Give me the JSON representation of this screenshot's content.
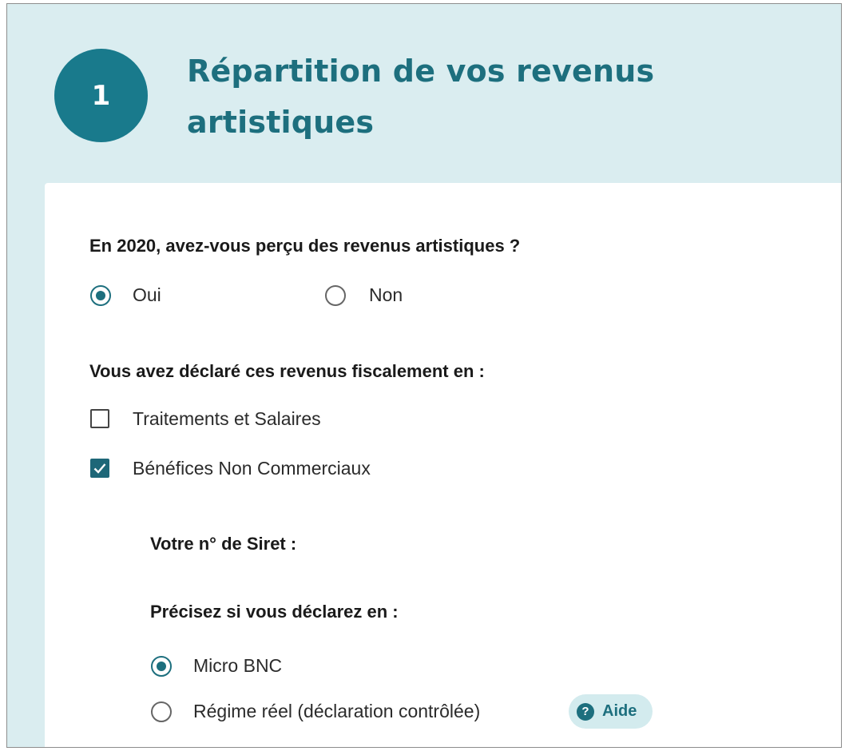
{
  "section": {
    "step_number": "1",
    "title": "Répartition de vos revenus artistiques"
  },
  "q_income": {
    "question": "En 2020, avez-vous perçu des revenus artistiques ?",
    "options": [
      {
        "label": "Oui",
        "selected": true
      },
      {
        "label": "Non",
        "selected": false
      }
    ]
  },
  "q_declared": {
    "question": "Vous avez déclaré ces revenus fiscalement en :",
    "options": [
      {
        "label": "Traitements et Salaires",
        "checked": false
      },
      {
        "label": "Bénéfices Non Commerciaux",
        "checked": true
      }
    ]
  },
  "bnc": {
    "siret_label": "Votre n° de Siret :",
    "regime_question": "Précisez si vous déclarez en :",
    "options": [
      {
        "label": "Micro BNC",
        "selected": true
      },
      {
        "label": "Régime réel (déclaration contrôlée)",
        "selected": false
      }
    ],
    "help": {
      "icon_text": "?",
      "label": "Aide"
    }
  },
  "colors": {
    "accent": "#1d6f7e",
    "header_bg": "#daedf0",
    "badge_bg": "#197a8c",
    "help_bg": "#d3ebee"
  }
}
